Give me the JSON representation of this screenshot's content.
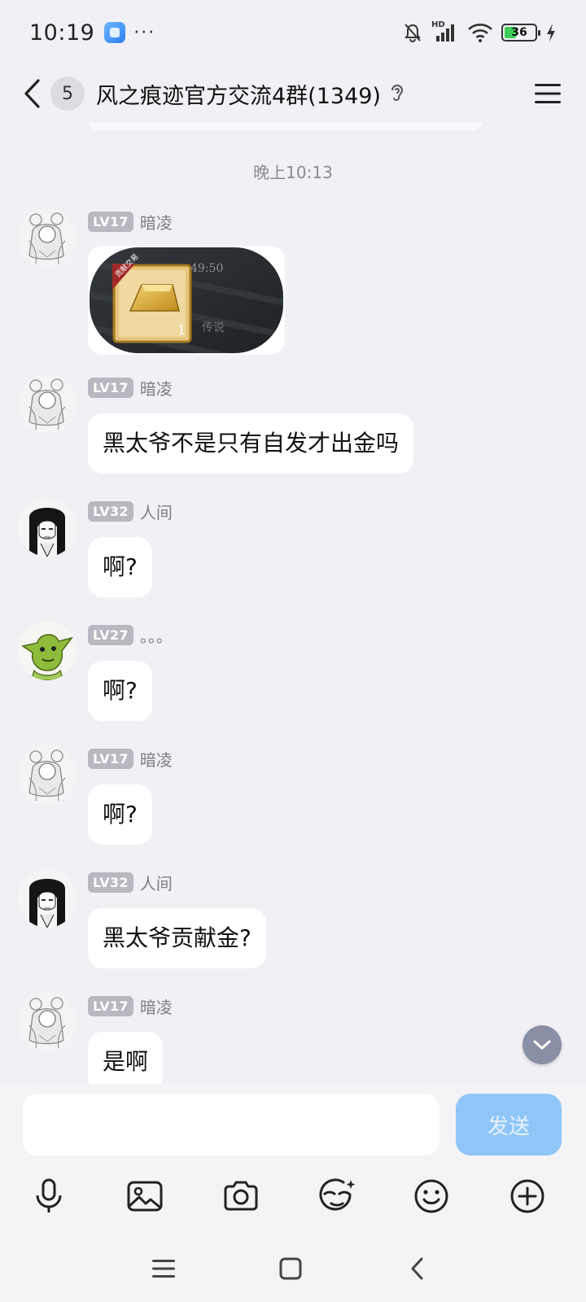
{
  "status_bar": {
    "time": "10:19",
    "more": "···",
    "battery_level": "36",
    "icons": [
      "app-icon",
      "mute-bell-icon",
      "signal-icon",
      "wifi-icon",
      "battery-icon",
      "charging-icon"
    ],
    "network_label": "HD"
  },
  "header": {
    "unread_count": "5",
    "title": "风之痕迹官方交流4群(1349)"
  },
  "chat": {
    "time_divider": "晚上10:13",
    "messages": [
      {
        "level": "LV17",
        "nickname": "暗凌",
        "type": "image",
        "avatar": "white-hair-avatar"
      },
      {
        "level": "LV17",
        "nickname": "暗凌",
        "text": "黑太爷不是只有自发才出金吗",
        "avatar": "white-hair-avatar"
      },
      {
        "level": "LV32",
        "nickname": "人间",
        "text": "啊?",
        "avatar": "black-hair-avatar"
      },
      {
        "level": "LV27",
        "nickname": "。。。",
        "text": "啊?",
        "avatar": "goblin-avatar"
      },
      {
        "level": "LV17",
        "nickname": "暗凌",
        "text": "啊?",
        "avatar": "white-hair-avatar"
      },
      {
        "level": "LV32",
        "nickname": "人间",
        "text": "黑太爷贡献金?",
        "avatar": "black-hair-avatar"
      },
      {
        "level": "LV17",
        "nickname": "暗凌",
        "text": "是啊",
        "avatar": "white-hair-avatar"
      }
    ],
    "image_card": {
      "ribbon": "贡献交易",
      "count": "1",
      "timer": "49:50",
      "sub_label": "传说"
    }
  },
  "input": {
    "value": "",
    "placeholder": "",
    "send_label": "发送"
  },
  "toolbar": [
    "microphone-icon",
    "image-icon",
    "camera-icon",
    "sticker-icon",
    "emoji-icon",
    "plus-icon"
  ],
  "system_nav": [
    "menu-icon",
    "home-icon",
    "back-icon"
  ],
  "colors": {
    "background": "#f1f1f5",
    "bubble": "#ffffff",
    "level_badge": "#b7b8c0",
    "send_button": "#8fc6f7",
    "gold": "#d9a93a"
  }
}
